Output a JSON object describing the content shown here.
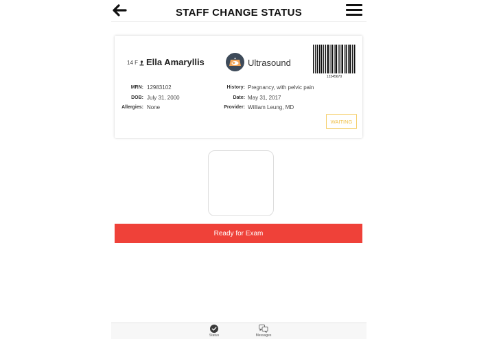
{
  "header": {
    "title": "STAFF CHANGE STATUS",
    "back_icon": "arrow-left-icon",
    "menu_icon": "hamburger-menu-icon"
  },
  "patient": {
    "age_sex": "14 F",
    "name": "Ella Amaryllis",
    "exam": "Ultrasound",
    "barcode_number": "12345670",
    "fields_left": [
      {
        "label": "MRN:",
        "value": "12983102"
      },
      {
        "label": "DOB:",
        "value": "July 31, 2000"
      },
      {
        "label": "Allergies:",
        "value": "None"
      }
    ],
    "fields_right": [
      {
        "label": "History:",
        "value": "Pregnancy, with pelvic pain"
      },
      {
        "label": "Date:",
        "value": "May 31, 2017"
      },
      {
        "label": "Provider:",
        "value": "William Leung, MD"
      }
    ],
    "status": "WAITING"
  },
  "action": {
    "ready_label": "Ready for Exam"
  },
  "tabbar": {
    "tabs": [
      {
        "label": "Status",
        "icon": "check-circle-icon"
      },
      {
        "label": "Messages",
        "icon": "chat-bubbles-icon"
      }
    ]
  },
  "colors": {
    "accent_red": "#ef4139",
    "waiting_yellow": "#f0c24c",
    "exam_icon_bg": "#3e4a59"
  }
}
